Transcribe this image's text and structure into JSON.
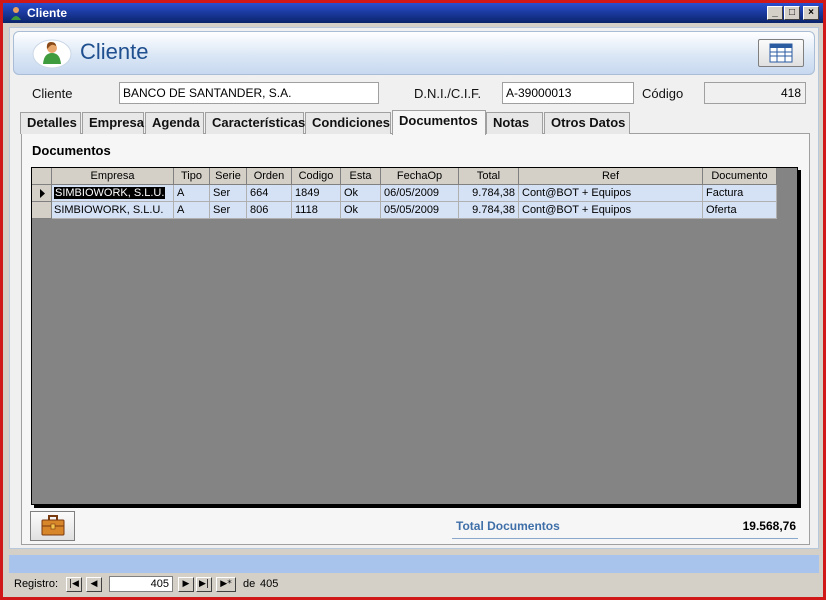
{
  "window": {
    "title": "Cliente"
  },
  "header": {
    "title": "Cliente"
  },
  "fields": {
    "cliente_label": "Cliente",
    "cliente_value": "BANCO DE SANTANDER, S.A.",
    "dni_label": "D.N.I./C.I.F.",
    "dni_value": "A-39000013",
    "codigo_label": "Código",
    "codigo_value": "418"
  },
  "tabs": [
    "Detalles",
    "Empresa",
    "Agenda",
    "Características",
    "Condiciones",
    "Documentos",
    "Notas",
    "Otros Datos"
  ],
  "active_tab": "Documentos",
  "section_title": "Documentos",
  "table": {
    "columns": [
      "Empresa",
      "Tipo",
      "Serie",
      "Orden",
      "Codigo",
      "Esta",
      "FechaOp",
      "Total",
      "Ref",
      "Documento"
    ],
    "rows": [
      [
        "SIMBIOWORK, S.L.U.",
        "A",
        "Ser",
        "664",
        "1849",
        "Ok",
        "06/05/2009",
        "9.784,38",
        "Cont@BOT + Equipos",
        "Factura"
      ],
      [
        "SIMBIOWORK, S.L.U.",
        "A",
        "Ser",
        "806",
        "1118",
        "Ok",
        "05/05/2009",
        "9.784,38",
        "Cont@BOT + Equipos",
        "Oferta"
      ]
    ]
  },
  "totals": {
    "label": "Total Documentos",
    "value": "19.568,76"
  },
  "status": {
    "registro_label": "Registro:",
    "current": "405",
    "de_label": "de",
    "total": "405"
  },
  "colors": {
    "header_text": "#1f4f8f",
    "row_bg": "#d5e1f4",
    "grid_bg": "#848484",
    "title_bar": "#0a246a",
    "bottom_bar": "#a8c4ec"
  }
}
